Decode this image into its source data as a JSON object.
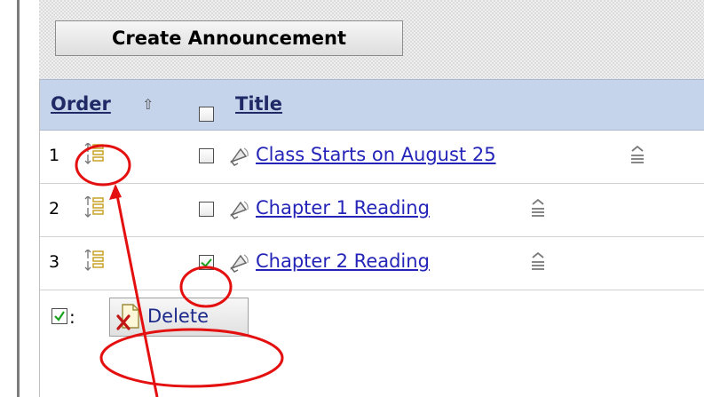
{
  "toolbar": {
    "create_label": "Create Announcement"
  },
  "table": {
    "headers": {
      "order": "Order",
      "title": "Title"
    },
    "rows": [
      {
        "order": "1",
        "title": "Class Starts on August 25",
        "checked": false
      },
      {
        "order": "2",
        "title": "Chapter 1 Reading",
        "checked": false
      },
      {
        "order": "3",
        "title": "Chapter 2 Reading",
        "checked": true
      }
    ]
  },
  "footer": {
    "delete_label": "Delete"
  },
  "colors": {
    "header_bg": "#c5d4ea",
    "link": "#2424b8",
    "annotation": "#e41010",
    "checkmark": "#19a31c"
  },
  "icons": [
    "sort-up-arrow-icon",
    "reorder-drag-icon",
    "announcement-megaphone-icon",
    "item-menu-chevron-icon",
    "delete-x-icon",
    "checked-selection-icon"
  ]
}
